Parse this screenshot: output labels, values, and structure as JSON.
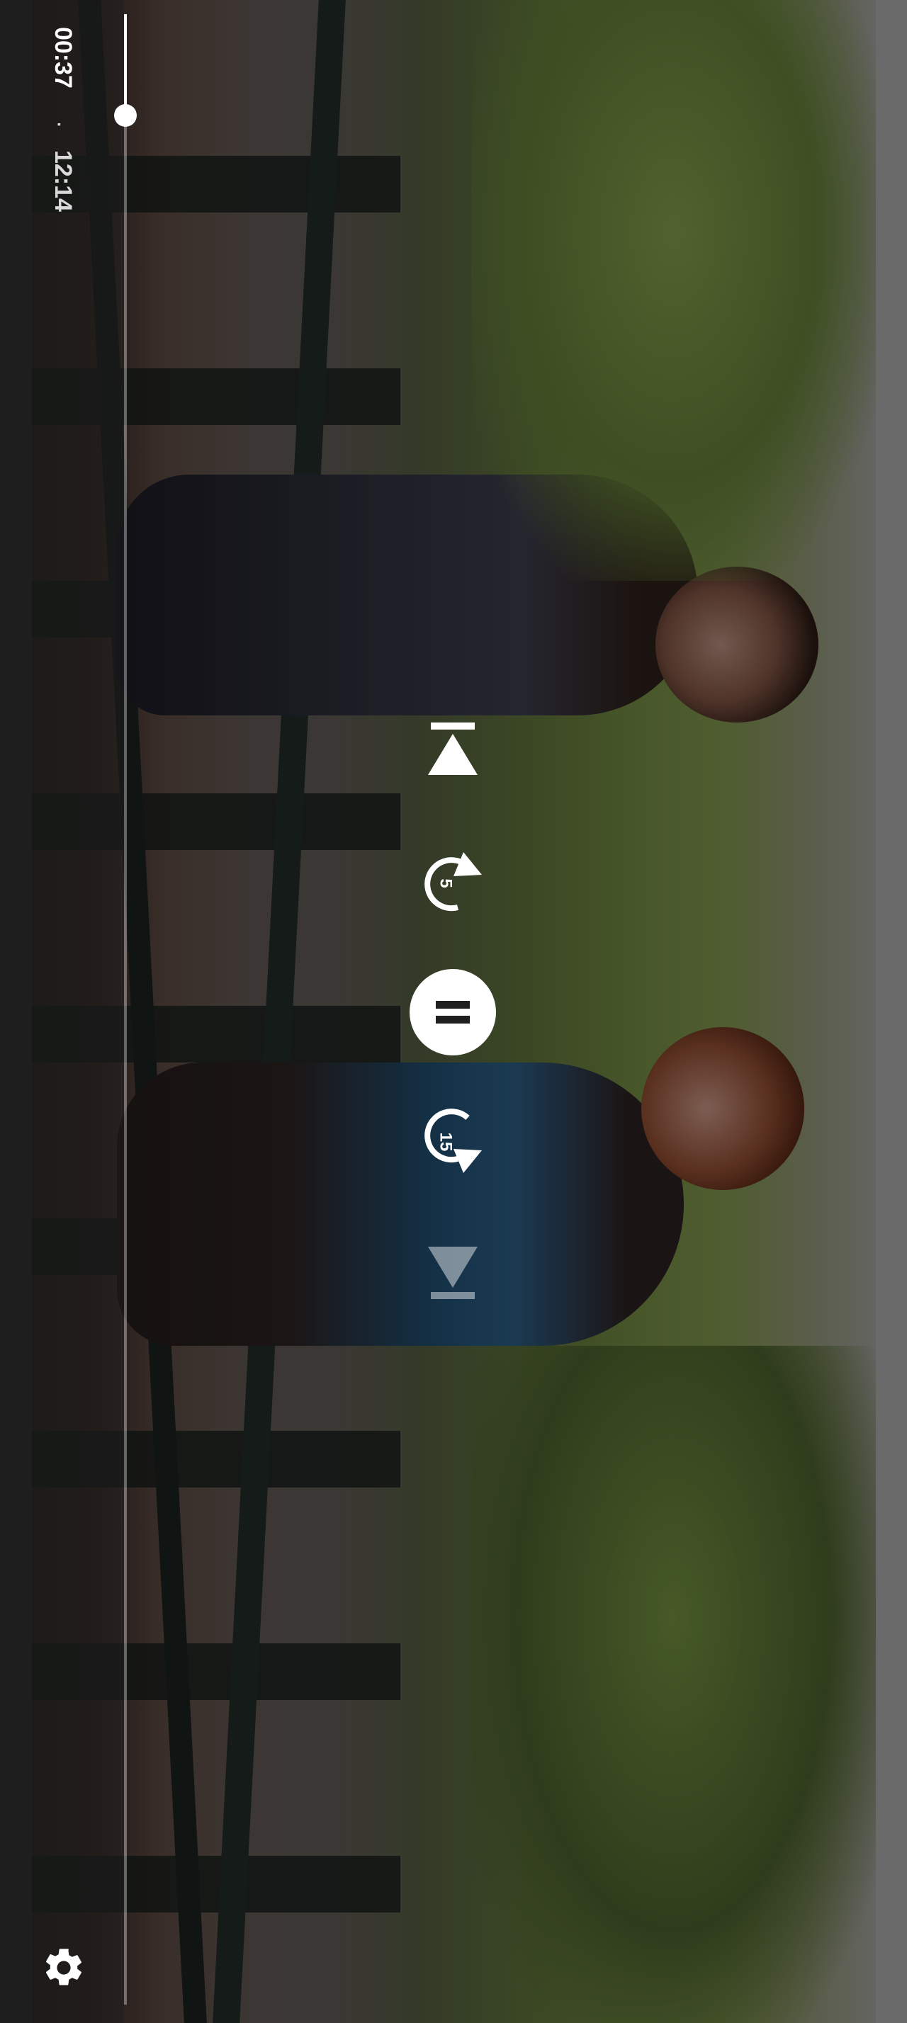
{
  "player": {
    "current_time": "00:37",
    "separator": "·",
    "total_time": "12:14",
    "progress_fraction": 0.05
  },
  "controls": {
    "rewind_seconds": "5",
    "forward_seconds": "15"
  },
  "icons": {
    "skip_previous": "skip-previous-icon",
    "rewind": "rewind-5-icon",
    "play_pause": "pause-icon",
    "forward": "forward-15-icon",
    "skip_next": "skip-next-icon",
    "settings": "gear-icon"
  },
  "colors": {
    "controls": "#ffffff",
    "background": "#1f1f1f"
  }
}
